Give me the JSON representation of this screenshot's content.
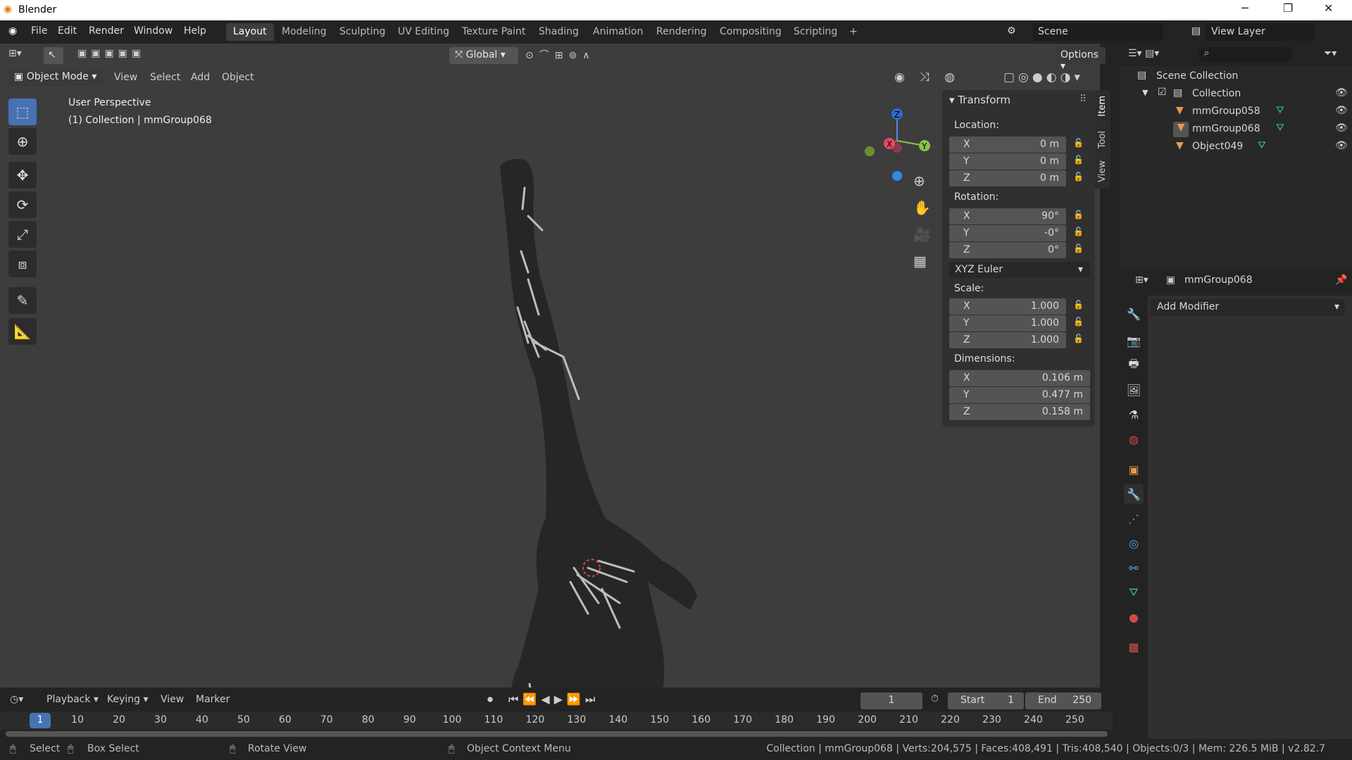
{
  "app": {
    "title": "Blender"
  },
  "window_controls": {
    "minimize": "─",
    "maximize": "❐",
    "close": "✕"
  },
  "menu": [
    "File",
    "Edit",
    "Render",
    "Window",
    "Help"
  ],
  "workspaces": [
    "Layout",
    "Modeling",
    "Sculpting",
    "UV Editing",
    "Texture Paint",
    "Shading",
    "Animation",
    "Rendering",
    "Compositing",
    "Scripting",
    "+"
  ],
  "active_workspace": "Layout",
  "scene": {
    "name": "Scene",
    "view_layer": "View Layer"
  },
  "tool_header": {
    "orientation": "Global",
    "options": "Options"
  },
  "viewport_header": {
    "mode": "Object Mode",
    "menus": [
      "View",
      "Select",
      "Add",
      "Object"
    ]
  },
  "viewport": {
    "perspective": "User Perspective",
    "context": "(1) Collection | mmGroup068"
  },
  "gizmo": {
    "x": "X",
    "y": "Y",
    "z": "Z"
  },
  "npanel": {
    "title": "Transform",
    "tabs": [
      "Item",
      "Tool",
      "View"
    ],
    "location_label": "Location:",
    "location": [
      {
        "k": "X",
        "v": "0 m"
      },
      {
        "k": "Y",
        "v": "0 m"
      },
      {
        "k": "Z",
        "v": "0 m"
      }
    ],
    "rotation_label": "Rotation:",
    "rotation": [
      {
        "k": "X",
        "v": "90°"
      },
      {
        "k": "Y",
        "v": "-0°"
      },
      {
        "k": "Z",
        "v": "0°"
      }
    ],
    "rotation_mode": "XYZ Euler",
    "scale_label": "Scale:",
    "scale": [
      {
        "k": "X",
        "v": "1.000"
      },
      {
        "k": "Y",
        "v": "1.000"
      },
      {
        "k": "Z",
        "v": "1.000"
      }
    ],
    "dimensions_label": "Dimensions:",
    "dimensions": [
      {
        "k": "X",
        "v": "0.106 m"
      },
      {
        "k": "Y",
        "v": "0.477 m"
      },
      {
        "k": "Z",
        "v": "0.158 m"
      }
    ]
  },
  "outliner": {
    "root": "Scene Collection",
    "collection": "Collection",
    "items": [
      "mmGroup058",
      "mmGroup068",
      "Object049"
    ],
    "active": "mmGroup068"
  },
  "properties": {
    "object": "mmGroup068",
    "add_modifier": "Add Modifier"
  },
  "timeline": {
    "menus": [
      "Playback",
      "Keying",
      "View",
      "Marker"
    ],
    "current_frame": "1",
    "start_label": "Start",
    "start": "1",
    "end_label": "End",
    "end": "250",
    "frames": [
      "1",
      "10",
      "20",
      "30",
      "40",
      "50",
      "60",
      "70",
      "80",
      "90",
      "100",
      "110",
      "120",
      "130",
      "140",
      "150",
      "160",
      "170",
      "180",
      "190",
      "200",
      "210",
      "220",
      "230",
      "240",
      "250"
    ]
  },
  "statusbar": {
    "select": "Select",
    "box_select": "Box Select",
    "rotate_view": "Rotate View",
    "context_menu": "Object Context Menu",
    "stats": "Collection | mmGroup068 | Verts:204,575 | Faces:408,491 | Tris:408,540 | Objects:0/3 | Mem: 226.5 MiB | v2.82.7"
  },
  "colors": {
    "accent": "#4772b3",
    "object_orange": "#e8994a",
    "mesh_green": "#3fc09a",
    "viewport_bg": "#3d3d3d"
  }
}
